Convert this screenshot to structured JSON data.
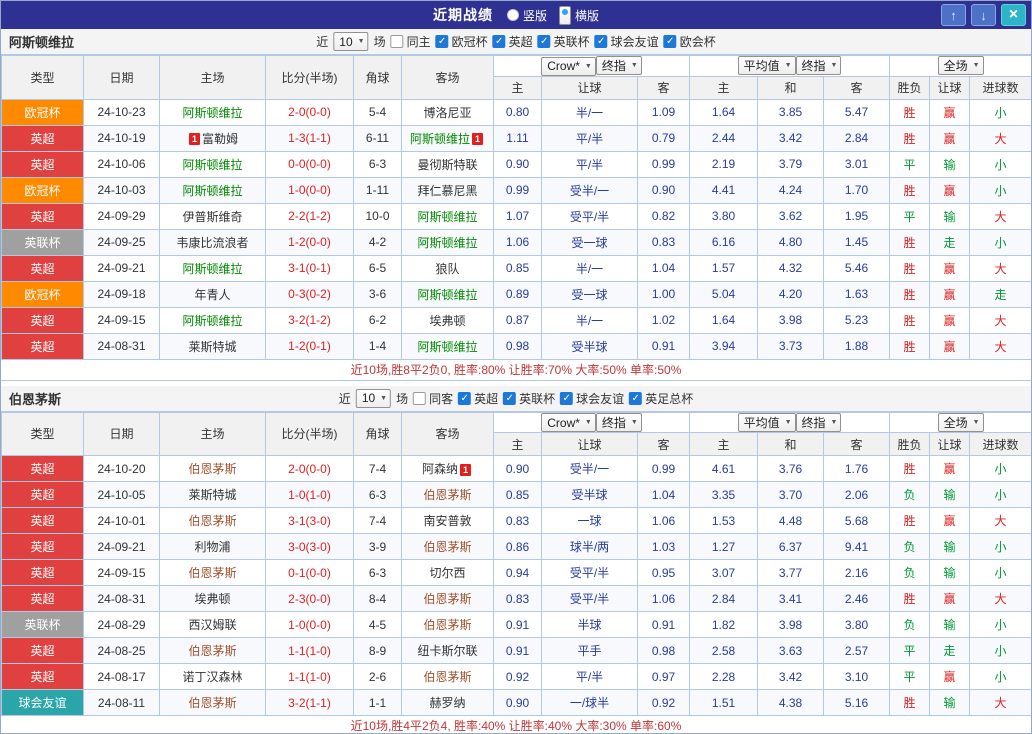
{
  "icons": {
    "up_arrow": "↑",
    "down_arrow": "↓",
    "close": "×",
    "dropdown_arrow": "▼",
    "checkmark": "✓"
  },
  "colors": {
    "titlebar_bg": "#2e3192",
    "grid_border": "#b3c9e3",
    "score_red": "#dd2222",
    "odds_blue": "#283c9c",
    "result_red": "#dd2222",
    "result_green": "#009933",
    "summary_red": "#c03636",
    "red_card": "#e02020",
    "checkbox_blue": "#1e78d7",
    "radio_blue": "#2ea0ff"
  },
  "league_colors": {
    "欧冠杯": "#ff8a00",
    "英超": "#e04040",
    "英联杯": "#a0a0a0",
    "球会友谊": "#2aa5a8"
  },
  "titlebar": {
    "title": "近期战绩",
    "radios": [
      {
        "label": "竖版",
        "selected": false
      },
      {
        "label": "横版",
        "selected": true
      }
    ]
  },
  "table_headers": {
    "main": [
      "类型",
      "日期",
      "主场",
      "比分(半场)",
      "角球",
      "客场"
    ],
    "sub": [
      "主",
      "让球",
      "客",
      "主",
      "和",
      "客",
      "胜负",
      "让球",
      "进球数"
    ]
  },
  "sections": [
    {
      "team": "阿斯顿维拉",
      "focus_color": "#008a00",
      "filter": {
        "prefix": "近",
        "count": "10",
        "suffix": "场",
        "same": {
          "label": "同主",
          "checked": false
        },
        "leagues": [
          {
            "label": "欧冠杯",
            "checked": true
          },
          {
            "label": "英超",
            "checked": true
          },
          {
            "label": "英联杯",
            "checked": true
          },
          {
            "label": "球会友谊",
            "checked": true
          },
          {
            "label": "欧会杯",
            "checked": true
          }
        ]
      },
      "selects": {
        "ah_book": "Crow*",
        "ah_time": "终指",
        "eu_source": "平均值",
        "eu_time": "终指",
        "scope": "全场"
      },
      "rows": [
        {
          "league": "欧冠杯",
          "date": "24-10-23",
          "home": {
            "name": "阿斯顿维拉",
            "focus": true
          },
          "away": {
            "name": "博洛尼亚"
          },
          "score": "2-0(0-0)",
          "corner": "5-4",
          "ah": [
            "0.80",
            "半/一",
            "1.09"
          ],
          "eu": [
            "1.64",
            "3.85",
            "5.47"
          ],
          "res": [
            [
              "胜",
              "r"
            ],
            [
              "赢",
              "r"
            ],
            [
              "小",
              "g"
            ]
          ]
        },
        {
          "league": "英超",
          "date": "24-10-19",
          "home": {
            "name": "富勒姆",
            "badge": "1",
            "badge_pos": "before"
          },
          "away": {
            "name": "阿斯顿维拉",
            "focus": true,
            "badge": "1",
            "badge_pos": "after"
          },
          "score": "1-3(1-1)",
          "corner": "6-11",
          "ah": [
            "1.11",
            "平/半",
            "0.79"
          ],
          "eu": [
            "2.44",
            "3.42",
            "2.84"
          ],
          "res": [
            [
              "胜",
              "r"
            ],
            [
              "赢",
              "r"
            ],
            [
              "大",
              "r"
            ]
          ]
        },
        {
          "league": "英超",
          "date": "24-10-06",
          "home": {
            "name": "阿斯顿维拉",
            "focus": true
          },
          "away": {
            "name": "曼彻斯特联"
          },
          "score": "0-0(0-0)",
          "corner": "6-3",
          "ah": [
            "0.90",
            "平/半",
            "0.99"
          ],
          "eu": [
            "2.19",
            "3.79",
            "3.01"
          ],
          "res": [
            [
              "平",
              "g"
            ],
            [
              "输",
              "g"
            ],
            [
              "小",
              "g"
            ]
          ]
        },
        {
          "league": "欧冠杯",
          "date": "24-10-03",
          "home": {
            "name": "阿斯顿维拉",
            "focus": true
          },
          "away": {
            "name": "拜仁慕尼黑"
          },
          "score": "1-0(0-0)",
          "corner": "1-11",
          "ah": [
            "0.99",
            "受半/一",
            "0.90"
          ],
          "eu": [
            "4.41",
            "4.24",
            "1.70"
          ],
          "res": [
            [
              "胜",
              "r"
            ],
            [
              "赢",
              "r"
            ],
            [
              "小",
              "g"
            ]
          ]
        },
        {
          "league": "英超",
          "date": "24-09-29",
          "home": {
            "name": "伊普斯维奇"
          },
          "away": {
            "name": "阿斯顿维拉",
            "focus": true
          },
          "score": "2-2(1-2)",
          "corner": "10-0",
          "ah": [
            "1.07",
            "受平/半",
            "0.82"
          ],
          "eu": [
            "3.80",
            "3.62",
            "1.95"
          ],
          "res": [
            [
              "平",
              "g"
            ],
            [
              "输",
              "g"
            ],
            [
              "大",
              "r"
            ]
          ]
        },
        {
          "league": "英联杯",
          "date": "24-09-25",
          "home": {
            "name": "韦康比流浪者"
          },
          "away": {
            "name": "阿斯顿维拉",
            "focus": true
          },
          "score": "1-2(0-0)",
          "corner": "4-2",
          "ah": [
            "1.06",
            "受一球",
            "0.83"
          ],
          "eu": [
            "6.16",
            "4.80",
            "1.45"
          ],
          "res": [
            [
              "胜",
              "r"
            ],
            [
              "走",
              "g"
            ],
            [
              "小",
              "g"
            ]
          ]
        },
        {
          "league": "英超",
          "date": "24-09-21",
          "home": {
            "name": "阿斯顿维拉",
            "focus": true
          },
          "away": {
            "name": "狼队"
          },
          "score": "3-1(0-1)",
          "corner": "6-5",
          "ah": [
            "0.85",
            "半/一",
            "1.04"
          ],
          "eu": [
            "1.57",
            "4.32",
            "5.46"
          ],
          "res": [
            [
              "胜",
              "r"
            ],
            [
              "赢",
              "r"
            ],
            [
              "大",
              "r"
            ]
          ]
        },
        {
          "league": "欧冠杯",
          "date": "24-09-18",
          "home": {
            "name": "年青人"
          },
          "away": {
            "name": "阿斯顿维拉",
            "focus": true
          },
          "score": "0-3(0-2)",
          "corner": "3-6",
          "ah": [
            "0.89",
            "受一球",
            "1.00"
          ],
          "eu": [
            "5.04",
            "4.20",
            "1.63"
          ],
          "res": [
            [
              "胜",
              "r"
            ],
            [
              "赢",
              "r"
            ],
            [
              "走",
              "g"
            ]
          ]
        },
        {
          "league": "英超",
          "date": "24-09-15",
          "home": {
            "name": "阿斯顿维拉",
            "focus": true
          },
          "away": {
            "name": "埃弗顿"
          },
          "score": "3-2(1-2)",
          "corner": "6-2",
          "ah": [
            "0.87",
            "半/一",
            "1.02"
          ],
          "eu": [
            "1.64",
            "3.98",
            "5.23"
          ],
          "res": [
            [
              "胜",
              "r"
            ],
            [
              "赢",
              "r"
            ],
            [
              "大",
              "r"
            ]
          ]
        },
        {
          "league": "英超",
          "date": "24-08-31",
          "home": {
            "name": "莱斯特城"
          },
          "away": {
            "name": "阿斯顿维拉",
            "focus": true
          },
          "score": "1-2(0-1)",
          "corner": "1-4",
          "ah": [
            "0.98",
            "受半球",
            "0.91"
          ],
          "eu": [
            "3.94",
            "3.73",
            "1.88"
          ],
          "res": [
            [
              "胜",
              "r"
            ],
            [
              "赢",
              "r"
            ],
            [
              "大",
              "r"
            ]
          ]
        }
      ],
      "summary": "近10场,胜8平2负0, 胜率:80% 让胜率:70% 大率:50% 单率:50%"
    },
    {
      "team": "伯恩茅斯",
      "focus_color": "#a0522d",
      "filter": {
        "prefix": "近",
        "count": "10",
        "suffix": "场",
        "same": {
          "label": "同客",
          "checked": false
        },
        "leagues": [
          {
            "label": "英超",
            "checked": true
          },
          {
            "label": "英联杯",
            "checked": true
          },
          {
            "label": "球会友谊",
            "checked": true
          },
          {
            "label": "英足总杯",
            "checked": true
          }
        ]
      },
      "selects": {
        "ah_book": "Crow*",
        "ah_time": "终指",
        "eu_source": "平均值",
        "eu_time": "终指",
        "scope": "全场"
      },
      "rows": [
        {
          "league": "英超",
          "date": "24-10-20",
          "home": {
            "name": "伯恩茅斯",
            "focus": true
          },
          "away": {
            "name": "阿森纳",
            "badge": "1",
            "badge_pos": "after"
          },
          "score": "2-0(0-0)",
          "corner": "7-4",
          "ah": [
            "0.90",
            "受半/一",
            "0.99"
          ],
          "eu": [
            "4.61",
            "3.76",
            "1.76"
          ],
          "res": [
            [
              "胜",
              "r"
            ],
            [
              "赢",
              "r"
            ],
            [
              "小",
              "g"
            ]
          ]
        },
        {
          "league": "英超",
          "date": "24-10-05",
          "home": {
            "name": "莱斯特城"
          },
          "away": {
            "name": "伯恩茅斯",
            "focus": true
          },
          "score": "1-0(1-0)",
          "corner": "6-3",
          "ah": [
            "0.85",
            "受半球",
            "1.04"
          ],
          "eu": [
            "3.35",
            "3.70",
            "2.06"
          ],
          "res": [
            [
              "负",
              "g"
            ],
            [
              "输",
              "g"
            ],
            [
              "小",
              "g"
            ]
          ]
        },
        {
          "league": "英超",
          "date": "24-10-01",
          "home": {
            "name": "伯恩茅斯",
            "focus": true
          },
          "away": {
            "name": "南安普敦"
          },
          "score": "3-1(3-0)",
          "corner": "7-4",
          "ah": [
            "0.83",
            "一球",
            "1.06"
          ],
          "eu": [
            "1.53",
            "4.48",
            "5.68"
          ],
          "res": [
            [
              "胜",
              "r"
            ],
            [
              "赢",
              "r"
            ],
            [
              "大",
              "r"
            ]
          ]
        },
        {
          "league": "英超",
          "date": "24-09-21",
          "home": {
            "name": "利物浦"
          },
          "away": {
            "name": "伯恩茅斯",
            "focus": true
          },
          "score": "3-0(3-0)",
          "corner": "3-9",
          "ah": [
            "0.86",
            "球半/两",
            "1.03"
          ],
          "eu": [
            "1.27",
            "6.37",
            "9.41"
          ],
          "res": [
            [
              "负",
              "g"
            ],
            [
              "输",
              "g"
            ],
            [
              "小",
              "g"
            ]
          ]
        },
        {
          "league": "英超",
          "date": "24-09-15",
          "home": {
            "name": "伯恩茅斯",
            "focus": true
          },
          "away": {
            "name": "切尔西"
          },
          "score": "0-1(0-0)",
          "corner": "6-3",
          "ah": [
            "0.94",
            "受平/半",
            "0.95"
          ],
          "eu": [
            "3.07",
            "3.77",
            "2.16"
          ],
          "res": [
            [
              "负",
              "g"
            ],
            [
              "输",
              "g"
            ],
            [
              "小",
              "g"
            ]
          ]
        },
        {
          "league": "英超",
          "date": "24-08-31",
          "home": {
            "name": "埃弗顿"
          },
          "away": {
            "name": "伯恩茅斯",
            "focus": true
          },
          "score": "2-3(0-0)",
          "corner": "8-4",
          "ah": [
            "0.83",
            "受平/半",
            "1.06"
          ],
          "eu": [
            "2.84",
            "3.41",
            "2.46"
          ],
          "res": [
            [
              "胜",
              "r"
            ],
            [
              "赢",
              "r"
            ],
            [
              "大",
              "r"
            ]
          ]
        },
        {
          "league": "英联杯",
          "date": "24-08-29",
          "home": {
            "name": "西汉姆联"
          },
          "away": {
            "name": "伯恩茅斯",
            "focus": true
          },
          "score": "1-0(0-0)",
          "corner": "4-5",
          "ah": [
            "0.91",
            "半球",
            "0.91"
          ],
          "eu": [
            "1.82",
            "3.98",
            "3.80"
          ],
          "res": [
            [
              "负",
              "g"
            ],
            [
              "输",
              "g"
            ],
            [
              "小",
              "g"
            ]
          ]
        },
        {
          "league": "英超",
          "date": "24-08-25",
          "home": {
            "name": "伯恩茅斯",
            "focus": true
          },
          "away": {
            "name": "纽卡斯尔联"
          },
          "score": "1-1(1-0)",
          "corner": "8-9",
          "ah": [
            "0.91",
            "平手",
            "0.98"
          ],
          "eu": [
            "2.58",
            "3.63",
            "2.57"
          ],
          "res": [
            [
              "平",
              "g"
            ],
            [
              "走",
              "g"
            ],
            [
              "小",
              "g"
            ]
          ]
        },
        {
          "league": "英超",
          "date": "24-08-17",
          "home": {
            "name": "诺丁汉森林"
          },
          "away": {
            "name": "伯恩茅斯",
            "focus": true
          },
          "score": "1-1(1-0)",
          "corner": "2-6",
          "ah": [
            "0.92",
            "平/半",
            "0.97"
          ],
          "eu": [
            "2.28",
            "3.42",
            "3.10"
          ],
          "res": [
            [
              "平",
              "g"
            ],
            [
              "赢",
              "r"
            ],
            [
              "小",
              "g"
            ]
          ]
        },
        {
          "league": "球会友谊",
          "date": "24-08-11",
          "home": {
            "name": "伯恩茅斯",
            "focus": true
          },
          "away": {
            "name": "赫罗纳"
          },
          "score": "3-2(1-1)",
          "corner": "1-1",
          "ah": [
            "0.90",
            "一/球半",
            "0.92"
          ],
          "eu": [
            "1.51",
            "4.38",
            "5.16"
          ],
          "res": [
            [
              "胜",
              "r"
            ],
            [
              "输",
              "g"
            ],
            [
              "大",
              "r"
            ]
          ]
        }
      ],
      "summary": "近10场,胜4平2负4, 胜率:40% 让胜率:40% 大率:30% 单率:60%"
    }
  ]
}
